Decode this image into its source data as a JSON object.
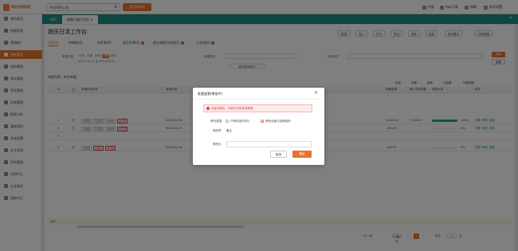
{
  "colors": {
    "accent": "#e8742c",
    "tabbar": "#1f8a85",
    "progress": "#22a58d",
    "danger": "#e53935"
  },
  "topbar": {
    "logo_text": "税控合同管理",
    "tenant_value": "XXXXXX公司",
    "quick_btn": "返回原网站",
    "icons": [
      {
        "icon": "bell-icon",
        "label": "消息"
      },
      {
        "icon": "download-icon",
        "label": "App下载"
      },
      {
        "icon": "help-icon",
        "label": "帮助"
      },
      {
        "icon": "user-icon",
        "label": "账号设置"
      }
    ]
  },
  "sidebar": {
    "items": [
      {
        "label": "我的首页",
        "active": false
      },
      {
        "label": "快捷导航",
        "active": false
      },
      {
        "label": "营销推广",
        "active": false
      },
      {
        "label": "销售管理",
        "active": true
      },
      {
        "label": "采购管理",
        "active": false
      },
      {
        "label": "库存管理",
        "active": false
      },
      {
        "label": "资金管理",
        "active": false
      },
      {
        "label": "应收管理",
        "active": false
      },
      {
        "label": "报表分析",
        "active": false
      },
      {
        "label": "基础资料",
        "active": false
      },
      {
        "label": "系统设置",
        "active": false
      },
      {
        "label": "企业合同",
        "active": false
      },
      {
        "label": "财务管理",
        "active": false
      },
      {
        "label": "应用中心",
        "active": false
      },
      {
        "label": "企业微信",
        "active": false
      },
      {
        "label": "帮助中心",
        "active": false
      }
    ]
  },
  "tabs": [
    {
      "label": "首页",
      "active": false
    },
    {
      "label": "销售日清工作台 ×",
      "active": true
    }
  ],
  "page": {
    "title": "销货日清工作台",
    "actions": [
      "新增",
      "导入",
      "打印",
      "导出",
      "更多",
      "批量",
      "显示模式",
      "切换视图"
    ],
    "subtabs": [
      {
        "label": "全部(0)",
        "active": true,
        "badge": ""
      },
      {
        "label": "待审核(0)",
        "active": false,
        "badge": ""
      },
      {
        "label": "待开票(0)",
        "active": false,
        "badge": ""
      },
      {
        "label": "部分开票(0)",
        "active": false,
        "badge": "2"
      },
      {
        "label": "部分收款已完成(0)",
        "active": false,
        "badge": "2"
      },
      {
        "label": "已关闭(0)",
        "active": false,
        "badge": "2"
      }
    ],
    "filters": {
      "date_label": "单据日期",
      "date_chips": [
        "今天",
        "本周",
        "本月",
        "本季",
        "本年"
      ],
      "date_range": "2023-01-01 至 2023-05-31",
      "type_label": "单据类型",
      "customer_label": "往来单位",
      "more_label": "展开更多条件",
      "query": "查询",
      "reset": "重置"
    },
    "list_title": "单据列表 · 待开单据",
    "toolbar": [
      "批量",
      "设置",
      "刷新",
      "列设置",
      "切换视图"
    ],
    "table": {
      "headers": [
        "#",
        "",
        "单据标签状态",
        "单据日期",
        "单号",
        "客户",
        "单据金额",
        "累计收款金额",
        "收款比例",
        "操作"
      ],
      "rows": [
        {
          "index": "1",
          "tags": [
            "已审核",
            "已开票",
            "未收款",
            "未开票"
          ],
          "date": "2023-05-30",
          "amount": "5,000.00",
          "received": "5,000.00",
          "percent": "100%",
          "progress": 1.0,
          "ops": [
            "查看",
            "修改",
            "复制"
          ]
        },
        {
          "index": "2",
          "tags": [
            "已审核",
            "已开票",
            "未收款",
            "未开票"
          ],
          "date": "2023-05-31",
          "amount": "-162.00",
          "received": "",
          "percent": "0%",
          "progress": 0.0,
          "ops": [
            "查看",
            "修改",
            "复制"
          ]
        },
        {
          "index": "3",
          "tags": [],
          "date": "",
          "amount": "",
          "received": "",
          "percent": "",
          "progress": null,
          "ops": []
        },
        {
          "index": "4",
          "tags": [
            "已审核",
            "未收款",
            "未开票"
          ],
          "date": "2023-05-26",
          "amount": "-180.00",
          "received": "",
          "percent": "0%",
          "progress": 0.0,
          "ops": [
            "查看",
            "修改",
            "复制"
          ]
        }
      ]
    },
    "sum_label": "合计",
    "pager": {
      "total": "共 4 条",
      "page": "1",
      "size": "10条/页",
      "goto": "前往",
      "goto_page": "1",
      "goto_unit": "页"
    }
  },
  "modal": {
    "title": "批量变更(审批中)",
    "alert": "批量变更后，可能无法恢复原数据",
    "mode_label": "修改范围",
    "radio1": "只修改选中的行",
    "radio2": "修改全部已经筛选的",
    "field_label": "修改项",
    "field_value": "备注",
    "value_label": "修改为",
    "value_placeholder": "",
    "cancel": "取消",
    "ok": "确定"
  }
}
